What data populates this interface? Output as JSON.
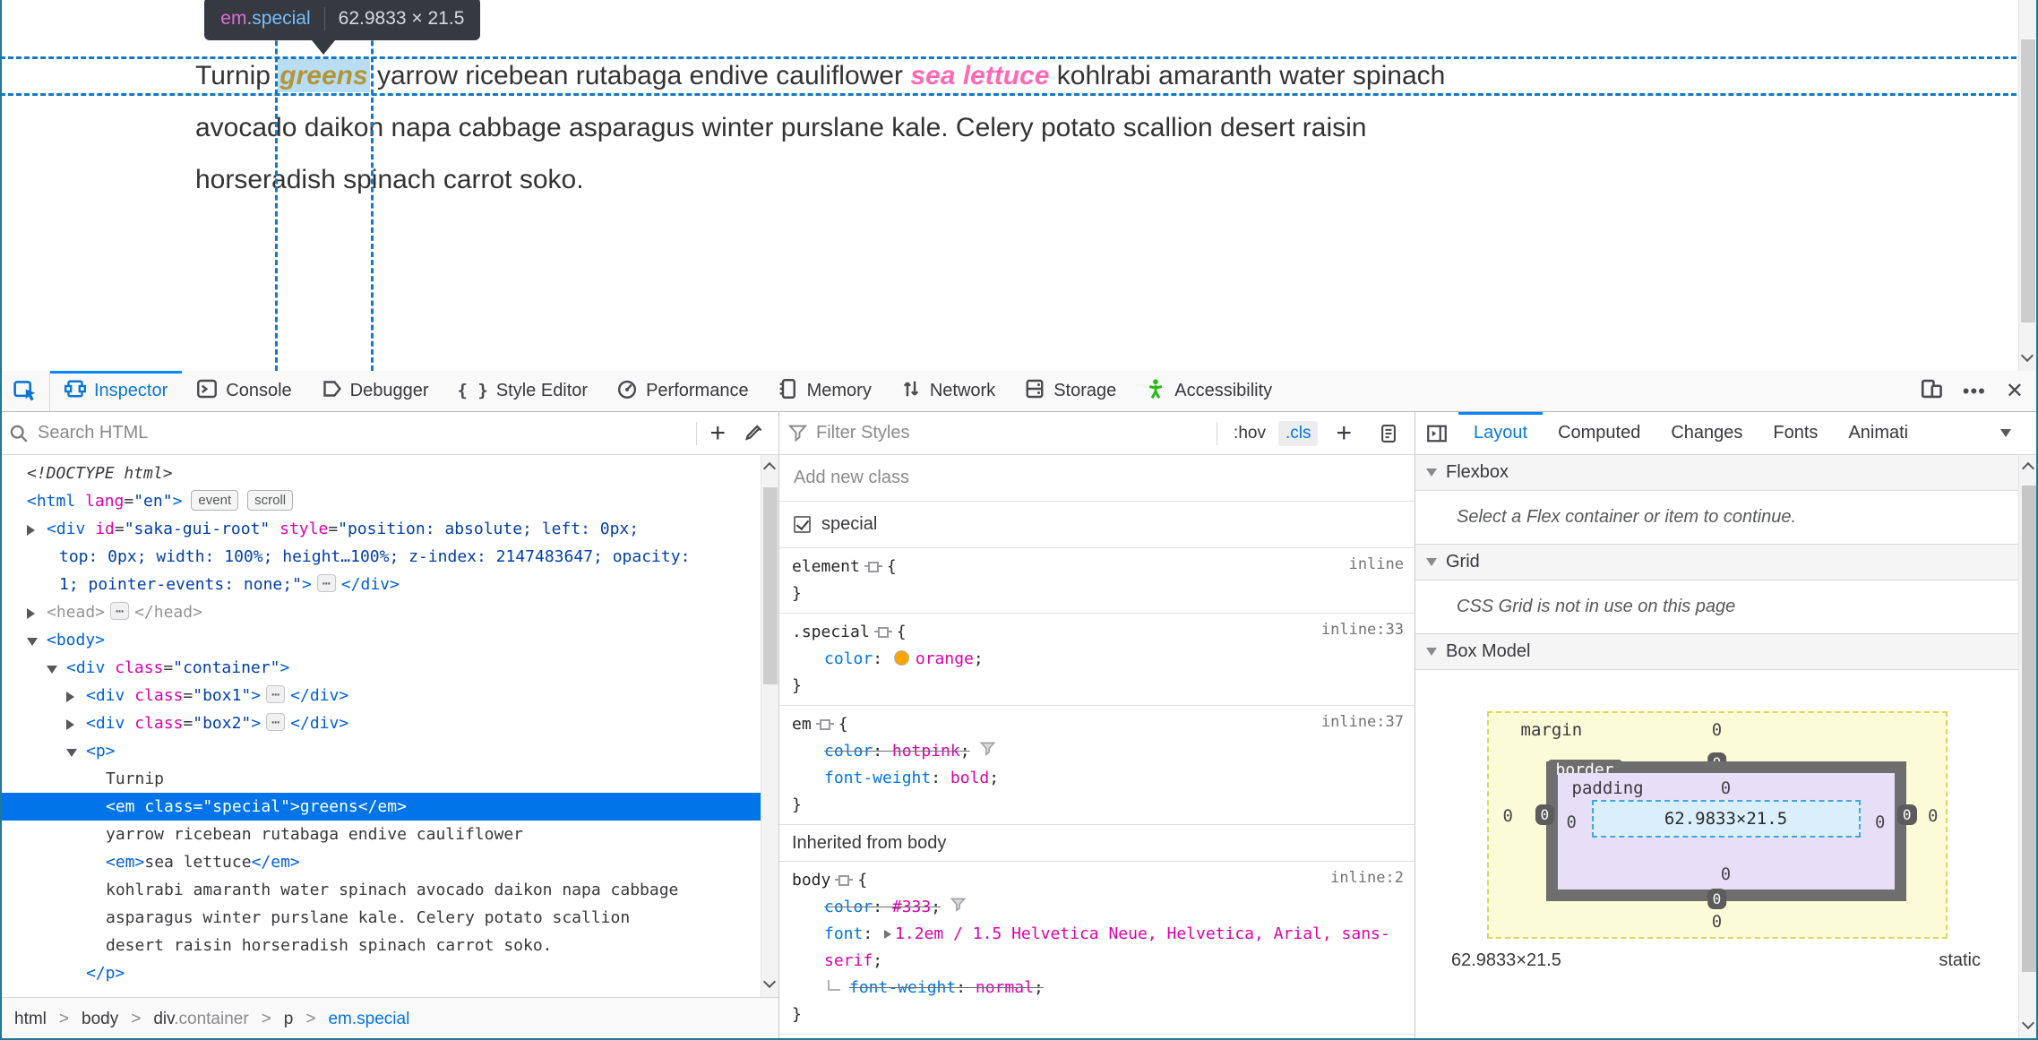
{
  "page": {
    "tooltip": {
      "tag": "em",
      "cls": ".special",
      "dims": "62.9833 × 21.5"
    },
    "paragraph": {
      "l1a": "Turnip ",
      "special": "greens",
      "l1b": " yarrow ricebean rutabaga endive cauliflower ",
      "em2": "sea lettuce",
      "l1c": " kohlrabi amaranth water spinach",
      "l2": "avocado daikon napa cabbage asparagus winter purslane kale. Celery potato scallion desert raisin",
      "l3": "horseradish spinach carrot soko."
    }
  },
  "tabbar": {
    "tabs": [
      {
        "id": "inspector",
        "label": "Inspector",
        "icon": "inspector",
        "active": true
      },
      {
        "id": "console",
        "label": "Console",
        "icon": "console",
        "active": false
      },
      {
        "id": "debugger",
        "label": "Debugger",
        "icon": "debugger",
        "active": false
      },
      {
        "id": "styleeditor",
        "label": "Style Editor",
        "icon": "braces",
        "active": false
      },
      {
        "id": "performance",
        "label": "Performance",
        "icon": "performance",
        "active": false
      },
      {
        "id": "memory",
        "label": "Memory",
        "icon": "memory",
        "active": false
      },
      {
        "id": "network",
        "label": "Network",
        "icon": "network",
        "active": false
      },
      {
        "id": "storage",
        "label": "Storage",
        "icon": "storage",
        "active": false
      },
      {
        "id": "accessibility",
        "label": "Accessibility",
        "icon": "accessibility",
        "active": false
      }
    ]
  },
  "markup": {
    "search_placeholder": "Search HTML",
    "tree": [
      {
        "pad": 30,
        "segs": [
          [
            "doc",
            "<!DOCTYPE html>"
          ]
        ]
      },
      {
        "pad": 30,
        "segs": [
          [
            "tag",
            "<html"
          ],
          [
            "attr",
            " lang"
          ],
          [
            "p",
            "="
          ],
          [
            "val",
            "\"en\""
          ],
          [
            "tag",
            ">"
          ],
          [
            "badge",
            "event"
          ],
          [
            "badge",
            "scroll"
          ]
        ]
      },
      {
        "pad": 52,
        "arrow": "r",
        "segs": [
          [
            "tag",
            "<div"
          ],
          [
            "attr",
            " id"
          ],
          [
            "p",
            "="
          ],
          [
            "val",
            "\"saka-gui-root\""
          ],
          [
            "attr",
            " style"
          ],
          [
            "p",
            "="
          ],
          [
            "val",
            "\"position: absolute; left: 0px;"
          ]
        ]
      },
      {
        "pad": 66,
        "segs": [
          [
            "val",
            "top: 0px; width: 100%; height…100%; z-index: 2147483647; opacity:"
          ]
        ]
      },
      {
        "pad": 66,
        "segs": [
          [
            "val",
            "1; pointer-events: none;\""
          ],
          [
            "tag",
            ">"
          ],
          [
            "ell",
            "⋯"
          ],
          [
            "tag",
            "</div>"
          ]
        ]
      },
      {
        "pad": 52,
        "arrow": "r",
        "segs": [
          [
            "gray",
            "<head>"
          ],
          [
            "ell",
            "⋯"
          ],
          [
            "gray",
            "</head>"
          ]
        ]
      },
      {
        "pad": 52,
        "arrow": "v",
        "segs": [
          [
            "tag",
            "<body>"
          ]
        ]
      },
      {
        "pad": 74,
        "arrow": "v",
        "segs": [
          [
            "tag",
            "<div"
          ],
          [
            "attr",
            " class"
          ],
          [
            "p",
            "="
          ],
          [
            "val",
            "\"container\""
          ],
          [
            "tag",
            ">"
          ]
        ]
      },
      {
        "pad": 96,
        "arrow": "r",
        "segs": [
          [
            "tag",
            "<div"
          ],
          [
            "attr",
            " class"
          ],
          [
            "p",
            "="
          ],
          [
            "val",
            "\"box1\""
          ],
          [
            "tag",
            ">"
          ],
          [
            "ell",
            "⋯"
          ],
          [
            "tag",
            "</div>"
          ]
        ]
      },
      {
        "pad": 96,
        "arrow": "r",
        "segs": [
          [
            "tag",
            "<div"
          ],
          [
            "attr",
            " class"
          ],
          [
            "p",
            "="
          ],
          [
            "val",
            "\"box2\""
          ],
          [
            "tag",
            ">"
          ],
          [
            "ell",
            "⋯"
          ],
          [
            "tag",
            "</div>"
          ]
        ]
      },
      {
        "pad": 96,
        "arrow": "v",
        "segs": [
          [
            "tag",
            "<p>"
          ]
        ]
      },
      {
        "pad": 118,
        "segs": [
          [
            "text",
            "Turnip"
          ]
        ]
      },
      {
        "pad": 118,
        "sel": true,
        "segs": [
          [
            "text",
            "<em class=\"special\">greens</em>"
          ]
        ]
      },
      {
        "pad": 118,
        "segs": [
          [
            "text",
            "yarrow ricebean rutabaga endive cauliflower"
          ]
        ]
      },
      {
        "pad": 118,
        "segs": [
          [
            "tag",
            "<em>"
          ],
          [
            "text",
            "sea lettuce"
          ],
          [
            "tag",
            "</em>"
          ]
        ]
      },
      {
        "pad": 118,
        "segs": [
          [
            "text",
            "kohlrabi amaranth water spinach avocado daikon napa cabbage"
          ]
        ]
      },
      {
        "pad": 118,
        "segs": [
          [
            "text",
            "asparagus winter purslane kale. Celery potato scallion"
          ]
        ]
      },
      {
        "pad": 118,
        "segs": [
          [
            "text",
            "desert raisin horseradish spinach carrot soko."
          ]
        ]
      },
      {
        "pad": 96,
        "segs": [
          [
            "tag",
            "</p>"
          ]
        ]
      }
    ],
    "breadcrumb": [
      {
        "label": "html"
      },
      {
        "label": "body"
      },
      {
        "label": "div",
        "muted": ".container"
      },
      {
        "label": "p"
      },
      {
        "label": "em.special",
        "active": true
      }
    ]
  },
  "rules": {
    "filter_placeholder": "Filter Styles",
    "hov_label": ":hov",
    "cls_label": ".cls",
    "add_class_placeholder": "Add new class",
    "class_toggles": [
      {
        "checked": true,
        "label": "special"
      }
    ],
    "blocks": [
      {
        "type": "rule",
        "selector": "element",
        "loc": "inline",
        "props": []
      },
      {
        "type": "rule",
        "selector": ".special",
        "loc": "inline:33",
        "props": [
          {
            "name": "color",
            "value": "orange",
            "swatch": "#ffa500"
          }
        ]
      },
      {
        "type": "rule",
        "selector": "em",
        "loc": "inline:37",
        "props": [
          {
            "name": "color",
            "value": "hotpink",
            "struck": true,
            "funnel": true
          },
          {
            "name": "font-weight",
            "value": "bold"
          }
        ]
      },
      {
        "type": "header",
        "text": "Inherited from body"
      },
      {
        "type": "rule",
        "selector": "body",
        "loc": "inline:2",
        "props": [
          {
            "name": "color",
            "value": "#333",
            "struck": true,
            "funnel": true
          },
          {
            "name": "font",
            "value": "1.2em / 1.5 Helvetica Neue, Helvetica, Arial, sans-serif",
            "expand": true
          },
          {
            "name": "font-weight",
            "value": "normal",
            "struck": true,
            "sub": true
          }
        ]
      }
    ]
  },
  "layout_panel": {
    "tabs": [
      {
        "label": "Layout",
        "active": true
      },
      {
        "label": "Computed",
        "active": false
      },
      {
        "label": "Changes",
        "active": false
      },
      {
        "label": "Fonts",
        "active": false
      },
      {
        "label": "Animati",
        "active": false
      }
    ],
    "flexbox": {
      "title": "Flexbox",
      "message": "Select a Flex container or item to continue."
    },
    "grid": {
      "title": "Grid",
      "message": "CSS Grid is not in use on this page"
    },
    "box_model": {
      "title": "Box Model",
      "margin_label": "margin",
      "border_label": "border",
      "padding_label": "padding",
      "margin": {
        "top": "0",
        "right": "0",
        "bottom": "0",
        "left": "0"
      },
      "border": {
        "top": "0",
        "right": "0",
        "bottom": "0",
        "left": "0"
      },
      "padding": {
        "top": "0",
        "right": "0",
        "bottom": "0",
        "left": "0"
      },
      "content": "62.9833×21.5",
      "footer_dims": "62.9833×21.5",
      "footer_position": "static"
    }
  }
}
